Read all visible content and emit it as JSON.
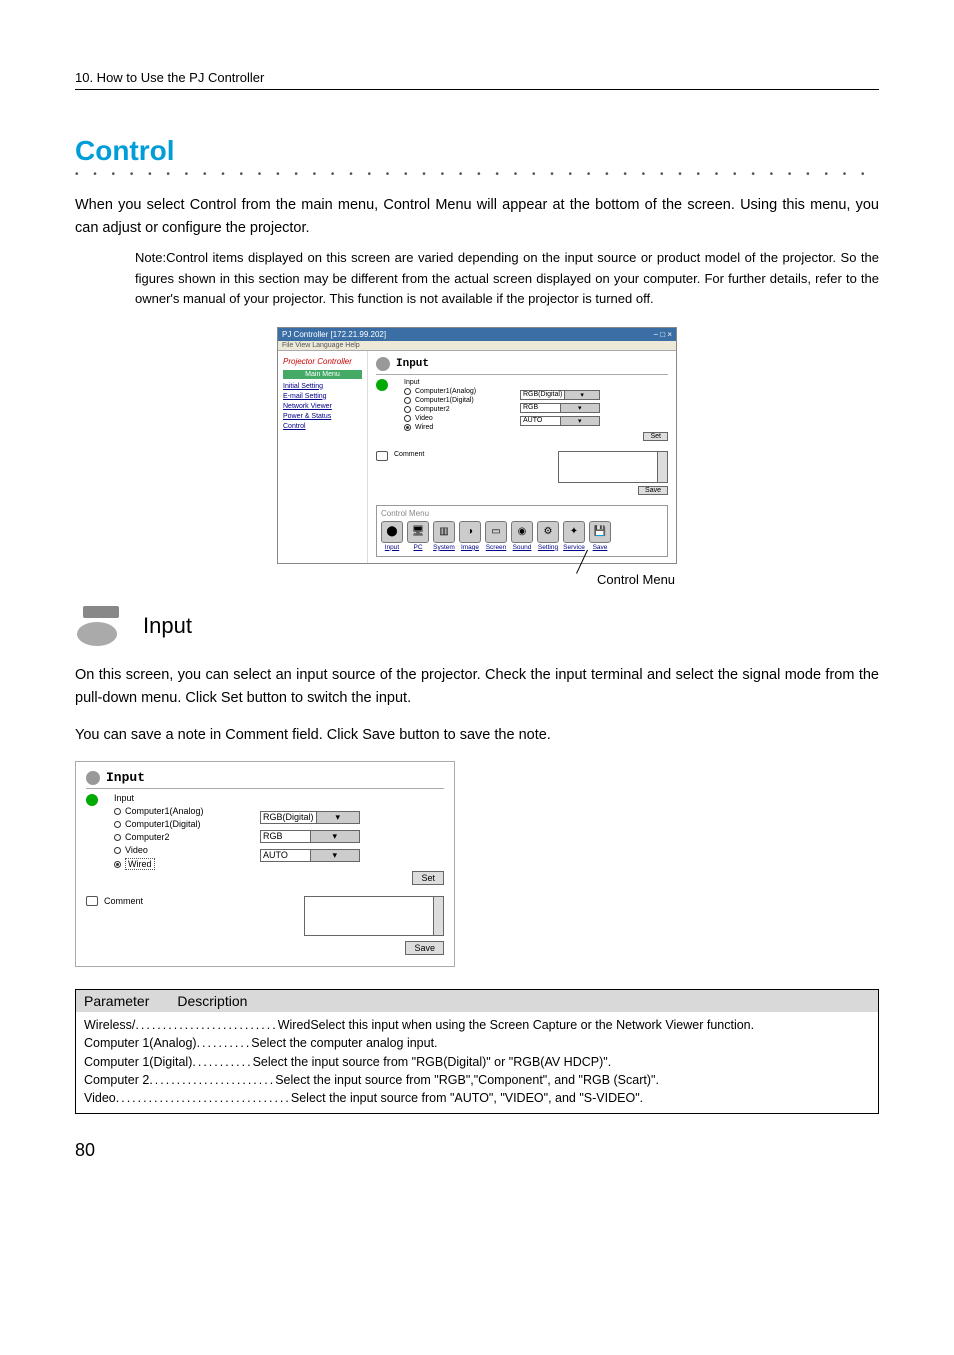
{
  "chapter": "10. How to Use the PJ Controller",
  "section_title": "Control",
  "intro": "When you select Control from the main menu, Control Menu will appear at the bottom of the screen. Using this menu, you can adjust or configure the projector.",
  "note": "Note:Control items displayed on this screen are varied depending on the input source or product model of the projector. So the figures shown in this section may be different from the actual screen displayed on your computer. For further details, refer to the owner's manual of your projector. This function is not available if the projector is turned off.",
  "app": {
    "title_prefix": "PJ Controller [",
    "title_ip": "172.21.99.202",
    "title_suffix": "]",
    "menubar": "File   View   Language   Help",
    "sidebar_logo": "Projector Controller",
    "sidebar_header": "Main Menu",
    "sidebar_items": [
      "Initial Setting",
      "E-mail Setting",
      "Network Viewer",
      "Power & Status",
      "Control"
    ]
  },
  "input_panel": {
    "heading": "Input",
    "label": "Input",
    "options": [
      "Computer1(Analog)",
      "Computer1(Digital)",
      "Computer2",
      "Video",
      "Wired"
    ],
    "selected_index": 4,
    "dropdowns": [
      "RGB(Digital)",
      "RGB",
      "AUTO"
    ],
    "set_btn": "Set",
    "comment_label": "Comment",
    "save_btn": "Save"
  },
  "control_menu": {
    "title": "Control Menu",
    "items": [
      {
        "label": "Input",
        "glyph": "⬤"
      },
      {
        "label": "PC",
        "glyph": "🖥"
      },
      {
        "label": "System",
        "glyph": "▥"
      },
      {
        "label": "Image",
        "glyph": "◑"
      },
      {
        "label": "Screen",
        "glyph": "▭"
      },
      {
        "label": "Sound",
        "glyph": "◉"
      },
      {
        "label": "Setting",
        "glyph": "⚙"
      },
      {
        "label": "Service",
        "glyph": "✦"
      },
      {
        "label": "Save",
        "glyph": "💾"
      }
    ]
  },
  "callout": "Control Menu",
  "sub_title": "Input",
  "body1": "On this screen, you can select an input source of the projector. Check the input terminal and select the signal mode from the pull-down menu. Click Set button to switch the input.",
  "body2": "You can save a note in Comment field. Click Save button to save the note.",
  "table": {
    "h1": "Parameter",
    "h2": "Description",
    "rows": [
      {
        "k": "Wireless/",
        "d": "..........................",
        "v": "WiredSelect this input when using the Screen Capture or the Network Viewer function."
      },
      {
        "k": "Computer 1(Analog)",
        "d": "..........",
        "v": "Select the computer analog input."
      },
      {
        "k": "Computer 1(Digital)",
        "d": "...........",
        "v": "Select the input source from \"RGB(Digital)\" or \"RGB(AV HDCP)\"."
      },
      {
        "k": "Computer 2",
        "d": ".......................",
        "v": "Select the input source from \"RGB\",\"Component\", and \"RGB (Scart)\"."
      },
      {
        "k": "Video",
        "d": "................................",
        "v": "Select the input source from \"AUTO\", \"VIDEO\", and \"S-VIDEO\"."
      }
    ]
  },
  "page_no": "80"
}
